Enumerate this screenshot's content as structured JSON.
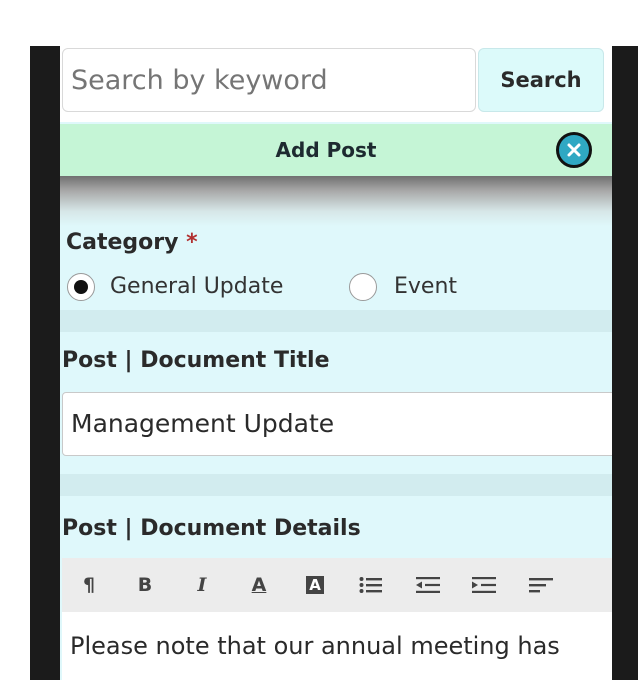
{
  "search": {
    "placeholder": "Search by keyword",
    "button_label": "Search"
  },
  "add_post": {
    "title": "Add Post"
  },
  "category": {
    "label": "Category",
    "required_marker": "*",
    "options": [
      {
        "label": "General Update",
        "selected": true
      },
      {
        "label": "Event",
        "selected": false
      }
    ]
  },
  "post_title": {
    "label": "Post | Document Title",
    "value": "Management Update"
  },
  "post_details": {
    "label": "Post | Document Details",
    "toolbar": [
      {
        "name": "paragraph-icon",
        "glyph": "¶"
      },
      {
        "name": "bold-icon",
        "glyph": "B"
      },
      {
        "name": "italic-icon",
        "glyph": "I"
      },
      {
        "name": "font-color-icon",
        "glyph": "A"
      },
      {
        "name": "highlight-icon",
        "glyph": "A"
      },
      {
        "name": "bullet-list-icon",
        "glyph": ""
      },
      {
        "name": "outdent-icon",
        "glyph": ""
      },
      {
        "name": "indent-icon",
        "glyph": ""
      },
      {
        "name": "align-left-icon",
        "glyph": ""
      }
    ],
    "body_text": "Please note that our annual meeting has"
  },
  "colors": {
    "screen_bg": "#dff8fb",
    "add_post_bar": "#c5f5d6",
    "search_button": "#dcfafa",
    "close_button": "#2fa8c3",
    "required": "#b13030"
  }
}
